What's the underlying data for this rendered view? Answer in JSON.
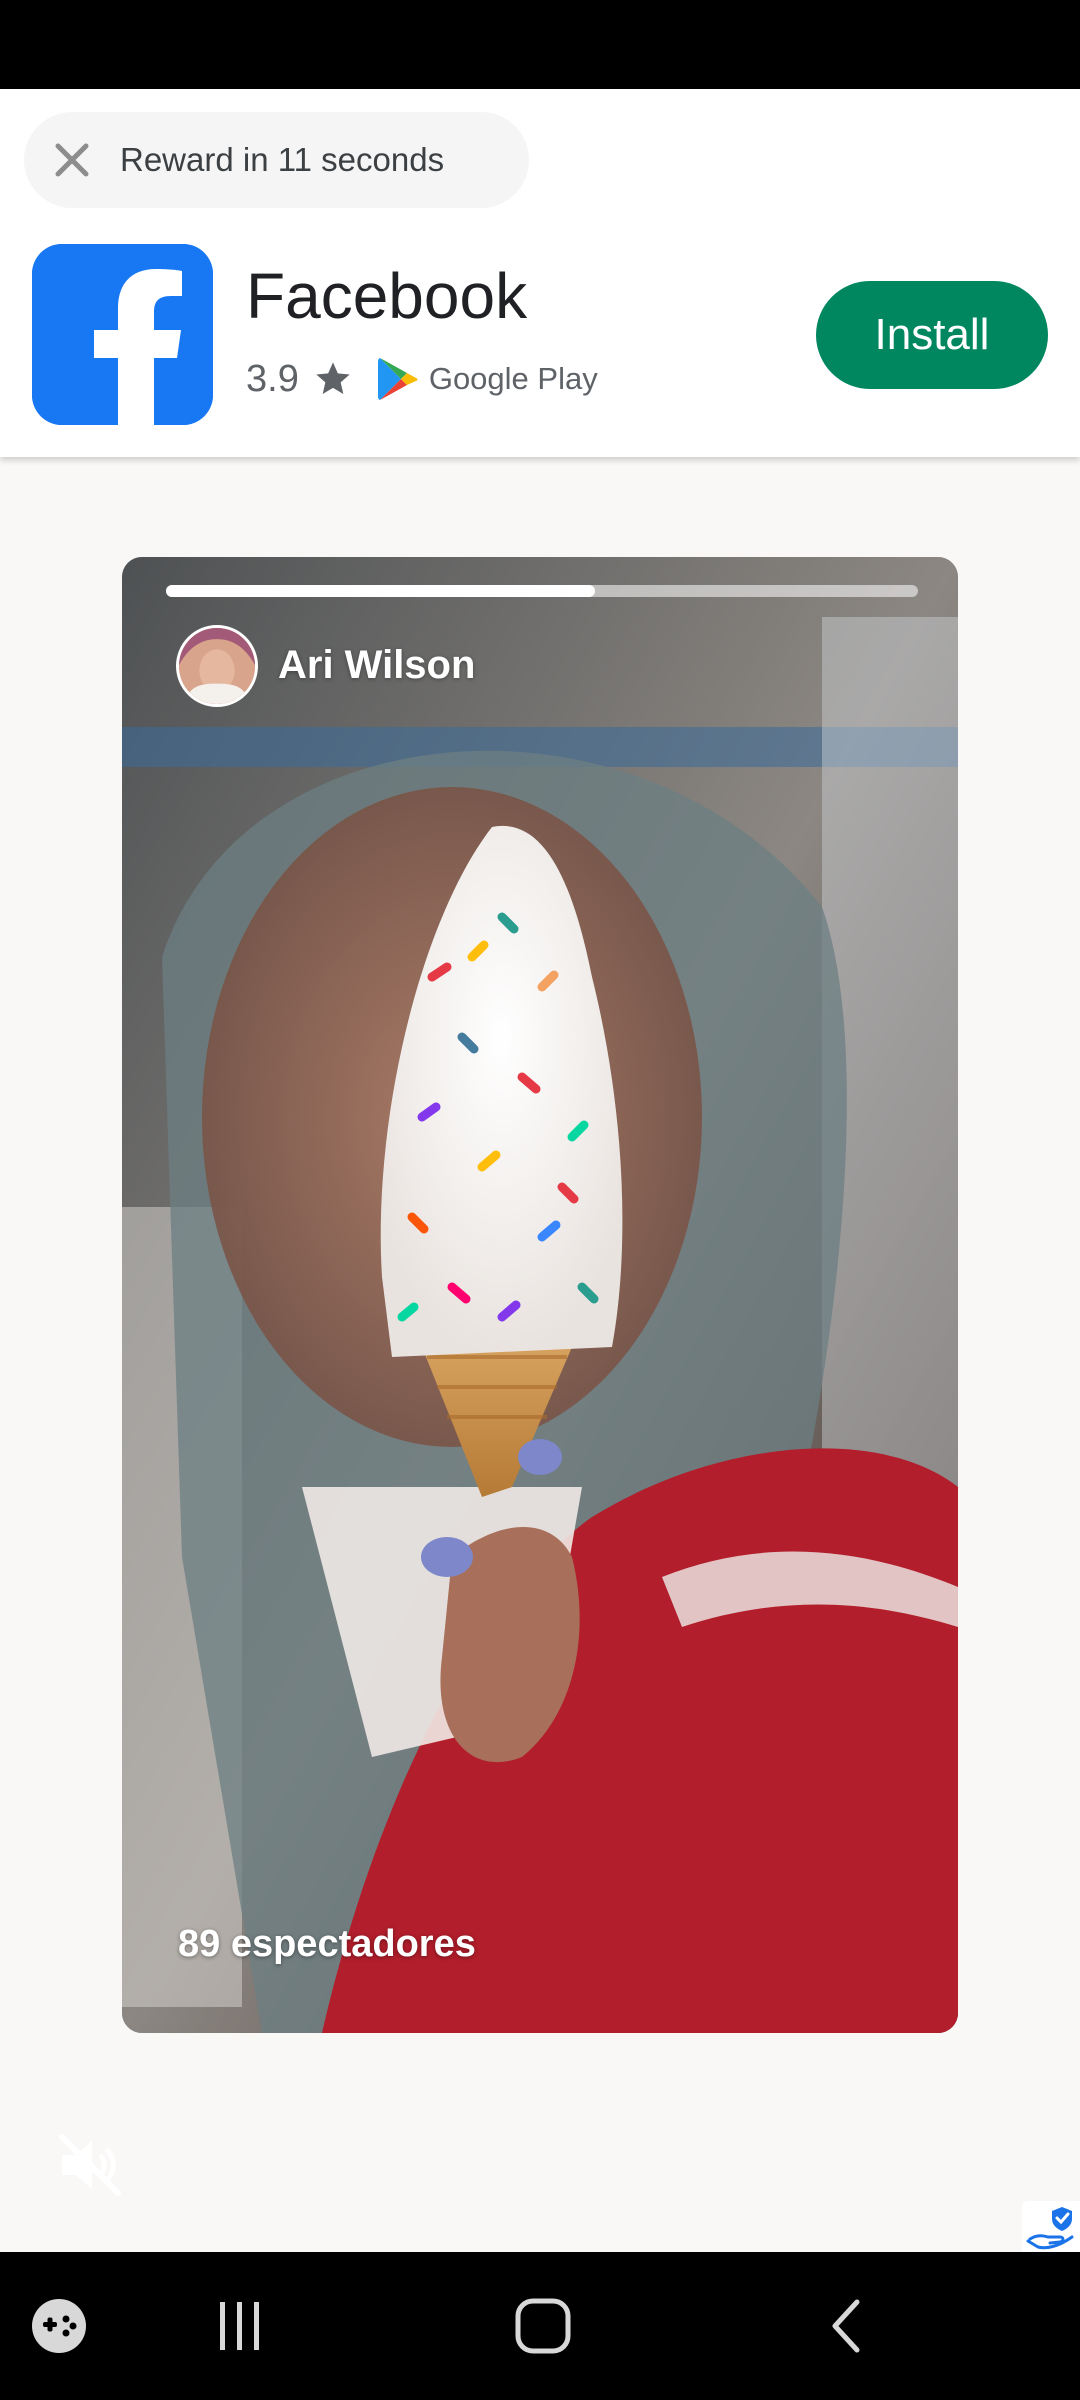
{
  "reward": {
    "text": "Reward in 11 seconds"
  },
  "app": {
    "name": "Facebook",
    "rating": "3.9",
    "store": "Google Play",
    "install_label": "Install",
    "icon_color": "#1877f2",
    "install_color": "#01875f"
  },
  "video": {
    "user_name": "Ari Wilson",
    "viewers_text": "89 espectadores",
    "progress": 0.57
  },
  "icons": {
    "close": "close-icon",
    "star": "star-icon",
    "play": "google-play-icon",
    "mute": "volume-off-icon",
    "adchoice": "ad-badge-icon",
    "nav_game": "game-launcher-icon",
    "nav_recents": "recents-icon",
    "nav_home": "home-icon",
    "nav_back": "back-icon"
  }
}
